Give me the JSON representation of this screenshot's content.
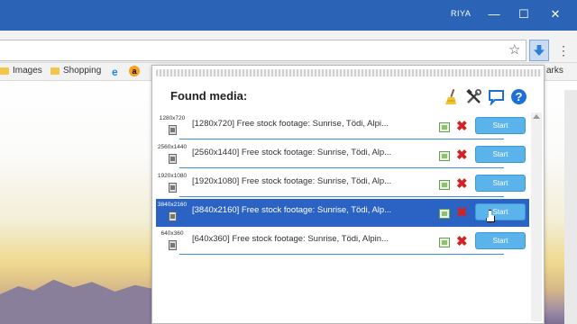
{
  "titlebar": {
    "user": "RIYA",
    "minimize": "—",
    "maximize": "☐",
    "close": "✕"
  },
  "toolbar": {
    "star": "☆",
    "menu": "⋮"
  },
  "bookmarks": {
    "images": "Images",
    "shopping": "Shopping",
    "more": "arks"
  },
  "popup": {
    "title": "Found media:",
    "tools": [
      "broom-icon",
      "tools-icon",
      "chat-icon",
      "help-icon"
    ],
    "help": "?",
    "start_label": "Start",
    "delete_glyph": "✖",
    "items": [
      {
        "res": "1280x720",
        "title": "[1280x720] Free stock footage: Sunrise, Tödi, Alpi...",
        "selected": false
      },
      {
        "res": "2560x1440",
        "title": "[2560x1440] Free stock footage: Sunrise, Tödi, Alp...",
        "selected": false
      },
      {
        "res": "1920x1080",
        "title": "[1920x1080] Free stock footage: Sunrise, Tödi, Alp...",
        "selected": false
      },
      {
        "res": "3840x2160",
        "title": "[3840x2160] Free stock footage: Sunrise, Tödi, Alp...",
        "selected": true
      },
      {
        "res": "640x360",
        "title": "[640x360] Free stock footage: Sunrise, Tödi, Alpin...",
        "selected": false
      }
    ]
  },
  "colors": {
    "titlebar": "#2b63b6",
    "selected_row": "#2a63c4",
    "start_button": "#5bb3ec",
    "delete": "#d42121"
  }
}
